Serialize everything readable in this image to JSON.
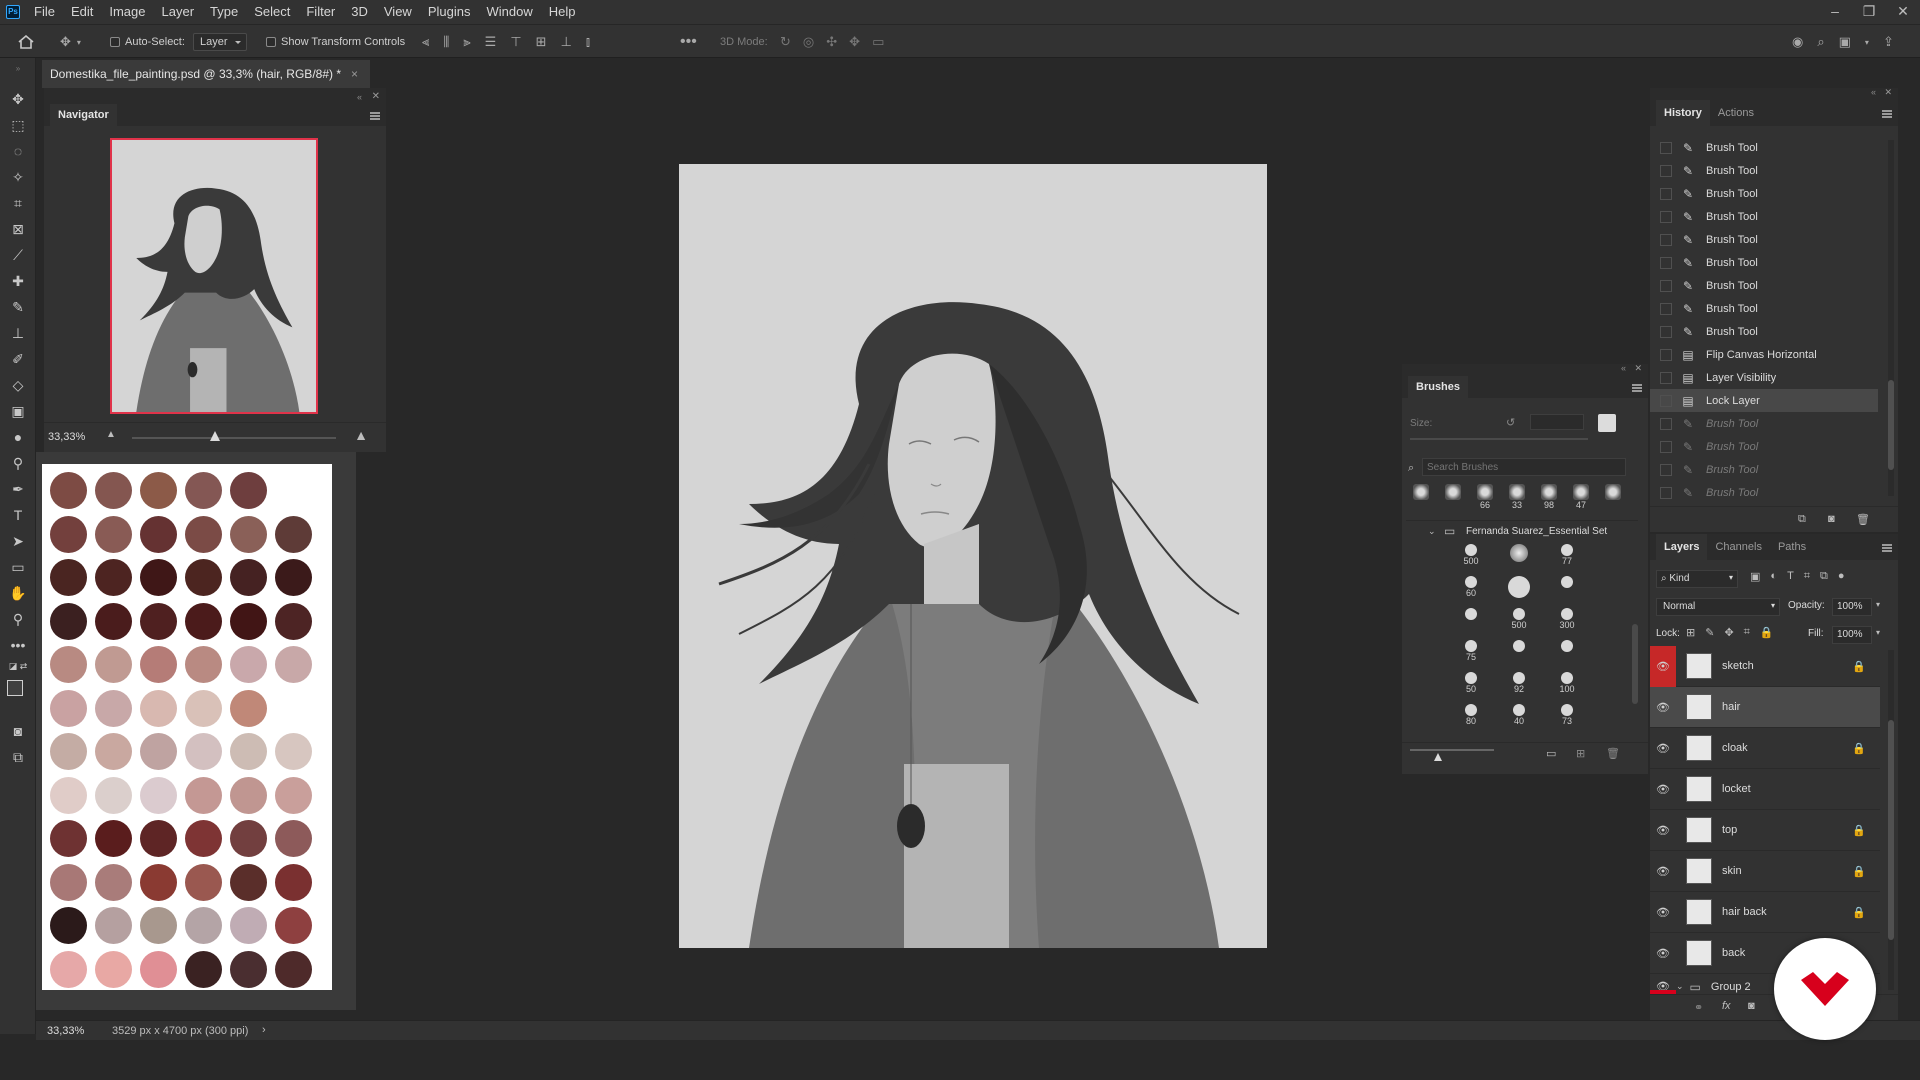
{
  "app": {
    "logo": "Ps",
    "accent": "#31a8ff"
  },
  "menu": [
    "File",
    "Edit",
    "Image",
    "Layer",
    "Type",
    "Select",
    "Filter",
    "3D",
    "View",
    "Plugins",
    "Window",
    "Help"
  ],
  "window_controls": {
    "minimize": "–",
    "restore": "❐",
    "close": "✕"
  },
  "options": {
    "auto_select_label": "Auto-Select:",
    "auto_select_value": "Layer",
    "show_transform_label": "Show Transform Controls",
    "mode_label": "3D Mode:"
  },
  "document_tab": {
    "title": "Domestika_file_painting.psd @ 33,3% (hair, RGB/8#) *",
    "close": "×"
  },
  "navigator": {
    "title": "Navigator",
    "zoom": "33,33%"
  },
  "swatch_colors": [
    [
      "#7d4b44",
      "#845650",
      "#8c5a48",
      "#845754",
      "#6e3e3e"
    ],
    [
      "#73403d",
      "#895b55",
      "#653232",
      "#7b4b46",
      "#8a6058",
      "#5e3b37"
    ],
    [
      "#4a2521",
      "#4d2421",
      "#3f1717",
      "#4c2520",
      "#452222",
      "#3b1a1a"
    ],
    [
      "#3b2020",
      "#4a1c1c",
      "#4f2020",
      "#4b1b1b",
      "#411515",
      "#4d2424"
    ],
    [
      "#b88a82",
      "#c09a92",
      "#b57c77",
      "#b98a82",
      "#c9a8ab",
      "#c8a8a8"
    ],
    [
      "#c9a2a2",
      "#c8a8a8",
      "#d8b8b0",
      "#d9c1b8",
      "#c08878"
    ],
    [
      "#c4aca4",
      "#c9a8a0",
      "#bfa3a1",
      "#d3c0c0",
      "#cdbcb4",
      "#d7c6c0"
    ],
    [
      "#e0ccc8",
      "#dbcfcc",
      "#dbcbcf",
      "#c49894",
      "#c09691",
      "#c99f9b"
    ],
    [
      "#6e3232",
      "#5a1d1d",
      "#5e2525",
      "#7e3434",
      "#723f3f",
      "#8d5a5a"
    ],
    [
      "#a87876",
      "#a97c7a",
      "#8a3a32",
      "#9a5850",
      "#5a2e2a",
      "#7a3030"
    ],
    [
      "#2b1a1a",
      "#b5a0a0",
      "#a8988e",
      "#b4a4a6",
      "#c0acb4",
      "#8e4040"
    ],
    [
      "#e6a8a8",
      "#e8a8a4",
      "#e08f95",
      "#3a2222",
      "#4a2e30",
      "#4e2a2a"
    ]
  ],
  "history": {
    "tabs": [
      "History",
      "Actions"
    ],
    "items": [
      {
        "label": "Brush Tool",
        "icon": "brush-icon",
        "state": "normal"
      },
      {
        "label": "Brush Tool",
        "icon": "brush-icon",
        "state": "normal"
      },
      {
        "label": "Brush Tool",
        "icon": "brush-icon",
        "state": "normal"
      },
      {
        "label": "Brush Tool",
        "icon": "brush-icon",
        "state": "normal"
      },
      {
        "label": "Brush Tool",
        "icon": "brush-icon",
        "state": "normal"
      },
      {
        "label": "Brush Tool",
        "icon": "brush-icon",
        "state": "normal"
      },
      {
        "label": "Brush Tool",
        "icon": "brush-icon",
        "state": "normal"
      },
      {
        "label": "Brush Tool",
        "icon": "brush-icon",
        "state": "normal"
      },
      {
        "label": "Brush Tool",
        "icon": "brush-icon",
        "state": "normal"
      },
      {
        "label": "Flip Canvas Horizontal",
        "icon": "document-icon",
        "state": "normal"
      },
      {
        "label": "Layer Visibility",
        "icon": "document-icon",
        "state": "normal"
      },
      {
        "label": "Lock Layer",
        "icon": "document-icon",
        "state": "selected"
      },
      {
        "label": "Brush Tool",
        "icon": "brush-icon",
        "state": "dim"
      },
      {
        "label": "Brush Tool",
        "icon": "brush-icon",
        "state": "dim"
      },
      {
        "label": "Brush Tool",
        "icon": "brush-icon",
        "state": "dim"
      },
      {
        "label": "Brush Tool",
        "icon": "brush-icon",
        "state": "dim"
      }
    ]
  },
  "brushes": {
    "title": "Brushes",
    "size_label": "Size:",
    "search_placeholder": "Search Brushes",
    "folder": "Fernanda Suarez_Essential Set",
    "recent_sizes": [
      "66",
      "33",
      "98",
      "47"
    ],
    "grid": [
      [
        "500",
        "",
        "77"
      ],
      [
        "60",
        "",
        ""
      ],
      [
        "",
        "500",
        "300"
      ],
      [
        "75",
        "",
        ""
      ],
      [
        "50",
        "92",
        "100"
      ],
      [
        "80",
        "40",
        "73"
      ]
    ]
  },
  "layers": {
    "tabs": [
      "Layers",
      "Channels",
      "Paths"
    ],
    "kind_label": "Kind",
    "blend_mode": "Normal",
    "opacity_label": "Opacity:",
    "opacity_value": "100%",
    "lock_label": "Lock:",
    "fill_label": "Fill:",
    "fill_value": "100%",
    "items": [
      {
        "name": "sketch",
        "locked": true,
        "visible": true
      },
      {
        "name": "hair",
        "locked": false,
        "visible": true
      },
      {
        "name": "cloak",
        "locked": true,
        "visible": true
      },
      {
        "name": "locket",
        "locked": false,
        "visible": true
      },
      {
        "name": "top",
        "locked": true,
        "visible": true
      },
      {
        "name": "skin",
        "locked": true,
        "visible": true
      },
      {
        "name": "hair back",
        "locked": true,
        "visible": true
      },
      {
        "name": "back",
        "locked": false,
        "visible": true
      }
    ],
    "group": "Group 2"
  },
  "status": {
    "zoom": "33,33%",
    "doc_info": "3529 px x 4700 px (300 ppi)"
  },
  "brand_badge_color": "#d7001c"
}
